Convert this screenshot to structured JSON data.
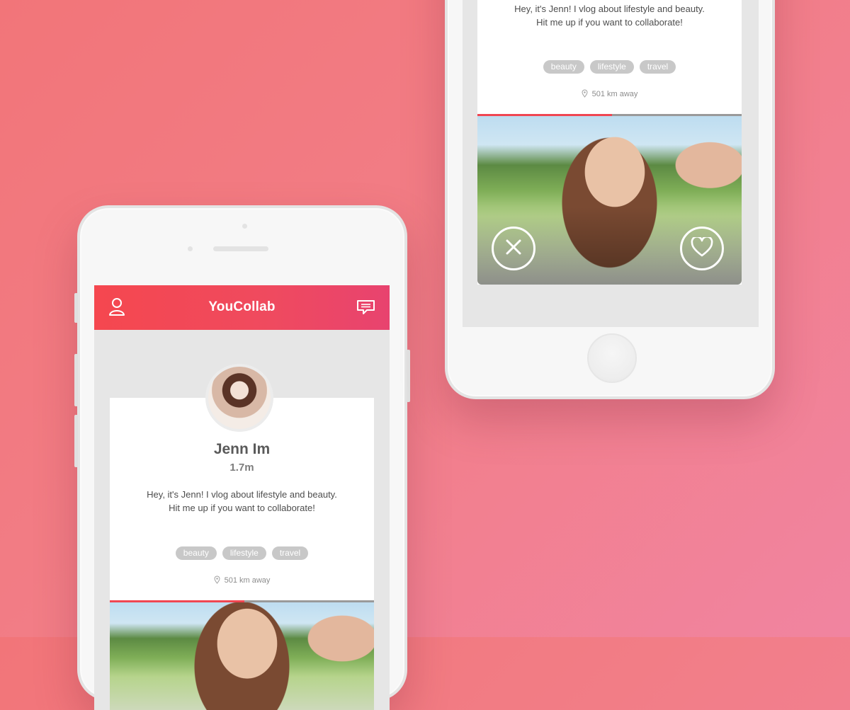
{
  "app": {
    "title": "YouCollab"
  },
  "profile": {
    "name": "Jenn Im",
    "followers": "1.7m",
    "bio": "Hey, it's Jenn! I vlog about lifestyle and beauty. Hit me up if you want to collaborate!",
    "tags": [
      "beauty",
      "lifestyle",
      "travel"
    ],
    "distance": "501 km away"
  },
  "icons": {
    "profile": "user-icon",
    "messages": "chat-icon",
    "location": "pin-icon",
    "dislike": "close-icon",
    "like": "heart-icon"
  },
  "colors": {
    "brand_red": "#f5474f",
    "brand_pink": "#e8436f",
    "tag_bg": "#c8c8c8",
    "progress": "#f04651"
  },
  "video": {
    "progress_fraction": 0.51
  }
}
